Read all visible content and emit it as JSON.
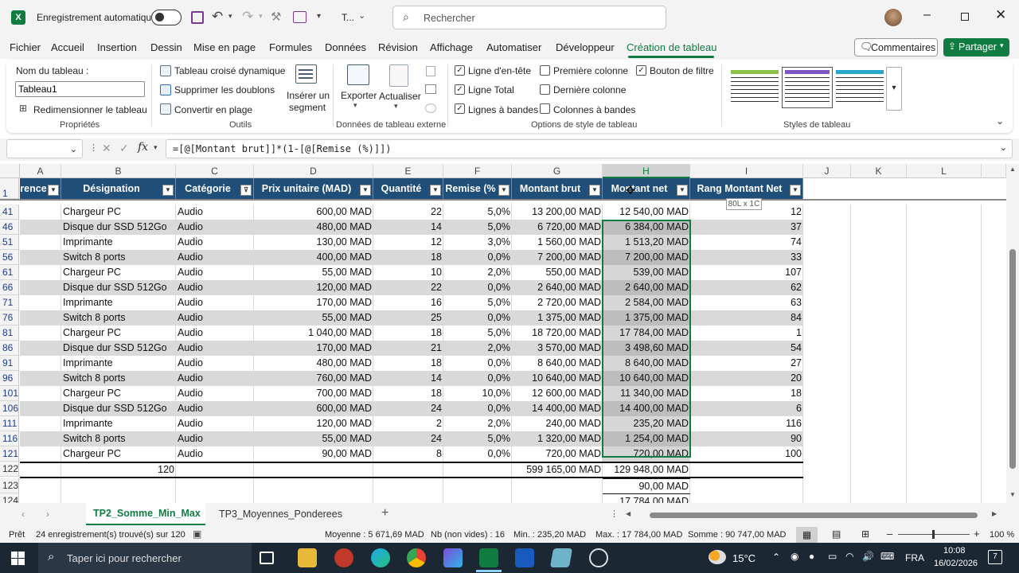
{
  "titlebar": {
    "autosave_label": "Enregistrement automatique",
    "doc_short": "T...",
    "search_placeholder": "Rechercher"
  },
  "menu": [
    "Fichier",
    "Accueil",
    "Insertion",
    "Dessin",
    "Mise en page",
    "Formules",
    "Données",
    "Révision",
    "Affichage",
    "Automatiser",
    "Développeur",
    "Création de tableau"
  ],
  "actions": {
    "comments": "Commentaires",
    "share": "Partager"
  },
  "ribbon": {
    "properties": {
      "table_name_label": "Nom du tableau :",
      "table_name_value": "Tableau1",
      "resize": "Redimensionner le tableau",
      "group": "Propriétés"
    },
    "tools": {
      "pivot": "Tableau croisé dynamique",
      "dedupe": "Supprimer les doublons",
      "convert": "Convertir en plage",
      "slicer_1": "Insérer un",
      "slicer_2": "segment",
      "group": "Outils"
    },
    "external": {
      "export": "Exporter",
      "refresh": "Actualiser",
      "group": "Données de tableau externe"
    },
    "style_options": {
      "header_row": "Ligne d'en-tête",
      "total_row": "Ligne Total",
      "banded_rows": "Lignes à bandes",
      "first_col": "Première colonne",
      "last_col": "Dernière colonne",
      "banded_cols": "Colonnes à bandes",
      "filter_button": "Bouton de filtre",
      "group": "Options de style de tableau"
    },
    "styles": {
      "group": "Styles de tableau"
    }
  },
  "formula": {
    "value": "=[@[Montant brut]]*(1-[@[Remise (%)]])"
  },
  "columns": [
    "A",
    "B",
    "C",
    "D",
    "E",
    "F",
    "G",
    "H",
    "I",
    "J",
    "K",
    "L"
  ],
  "table_headers": [
    "rence",
    "Désignation",
    "Catégorie",
    "Prix unitaire (MAD)",
    "Quantité",
    "Remise (%",
    "Montant brut",
    "Montant net",
    "Rang Montant Net"
  ],
  "tooltip": "80L x 1C",
  "rows": [
    {
      "n": "41",
      "b": "Chargeur PC",
      "c": "Audio",
      "d": "600,00 MAD",
      "e": "22",
      "f": "5,0%",
      "g": "13 200,00 MAD",
      "h": "12 540,00 MAD",
      "i": "12"
    },
    {
      "n": "46",
      "b": "Disque dur SSD 512Go",
      "c": "Audio",
      "d": "480,00 MAD",
      "e": "14",
      "f": "5,0%",
      "g": "6 720,00 MAD",
      "h": "6 384,00 MAD",
      "i": "37"
    },
    {
      "n": "51",
      "b": "Imprimante",
      "c": "Audio",
      "d": "130,00 MAD",
      "e": "12",
      "f": "3,0%",
      "g": "1 560,00 MAD",
      "h": "1 513,20 MAD",
      "i": "74"
    },
    {
      "n": "56",
      "b": "Switch 8 ports",
      "c": "Audio",
      "d": "400,00 MAD",
      "e": "18",
      "f": "0,0%",
      "g": "7 200,00 MAD",
      "h": "7 200,00 MAD",
      "i": "33"
    },
    {
      "n": "61",
      "b": "Chargeur PC",
      "c": "Audio",
      "d": "55,00 MAD",
      "e": "10",
      "f": "2,0%",
      "g": "550,00 MAD",
      "h": "539,00 MAD",
      "i": "107"
    },
    {
      "n": "66",
      "b": "Disque dur SSD 512Go",
      "c": "Audio",
      "d": "120,00 MAD",
      "e": "22",
      "f": "0,0%",
      "g": "2 640,00 MAD",
      "h": "2 640,00 MAD",
      "i": "62"
    },
    {
      "n": "71",
      "b": "Imprimante",
      "c": "Audio",
      "d": "170,00 MAD",
      "e": "16",
      "f": "5,0%",
      "g": "2 720,00 MAD",
      "h": "2 584,00 MAD",
      "i": "63"
    },
    {
      "n": "76",
      "b": "Switch 8 ports",
      "c": "Audio",
      "d": "55,00 MAD",
      "e": "25",
      "f": "0,0%",
      "g": "1 375,00 MAD",
      "h": "1 375,00 MAD",
      "i": "84"
    },
    {
      "n": "81",
      "b": "Chargeur PC",
      "c": "Audio",
      "d": "1 040,00 MAD",
      "e": "18",
      "f": "5,0%",
      "g": "18 720,00 MAD",
      "h": "17 784,00 MAD",
      "i": "1"
    },
    {
      "n": "86",
      "b": "Disque dur SSD 512Go",
      "c": "Audio",
      "d": "170,00 MAD",
      "e": "21",
      "f": "2,0%",
      "g": "3 570,00 MAD",
      "h": "3 498,60 MAD",
      "i": "54"
    },
    {
      "n": "91",
      "b": "Imprimante",
      "c": "Audio",
      "d": "480,00 MAD",
      "e": "18",
      "f": "0,0%",
      "g": "8 640,00 MAD",
      "h": "8 640,00 MAD",
      "i": "27"
    },
    {
      "n": "96",
      "b": "Switch 8 ports",
      "c": "Audio",
      "d": "760,00 MAD",
      "e": "14",
      "f": "0,0%",
      "g": "10 640,00 MAD",
      "h": "10 640,00 MAD",
      "i": "20"
    },
    {
      "n": "101",
      "b": "Chargeur PC",
      "c": "Audio",
      "d": "700,00 MAD",
      "e": "18",
      "f": "10,0%",
      "g": "12 600,00 MAD",
      "h": "11 340,00 MAD",
      "i": "18"
    },
    {
      "n": "106",
      "b": "Disque dur SSD 512Go",
      "c": "Audio",
      "d": "600,00 MAD",
      "e": "24",
      "f": "0,0%",
      "g": "14 400,00 MAD",
      "h": "14 400,00 MAD",
      "i": "6"
    },
    {
      "n": "111",
      "b": "Imprimante",
      "c": "Audio",
      "d": "120,00 MAD",
      "e": "2",
      "f": "2,0%",
      "g": "240,00 MAD",
      "h": "235,20 MAD",
      "i": "116"
    },
    {
      "n": "116",
      "b": "Switch 8 ports",
      "c": "Audio",
      "d": "55,00 MAD",
      "e": "24",
      "f": "5,0%",
      "g": "1 320,00 MAD",
      "h": "1 254,00 MAD",
      "i": "90"
    },
    {
      "n": "121",
      "b": "Chargeur PC",
      "c": "Audio",
      "d": "90,00 MAD",
      "e": "8",
      "f": "0,0%",
      "g": "720,00 MAD",
      "h": "720,00 MAD",
      "i": "100"
    }
  ],
  "total_row": {
    "n": "122",
    "b": "120",
    "g": "599 165,00 MAD",
    "h": "129 948,00 MAD"
  },
  "extra_rows": [
    {
      "n": "123",
      "h": "90,00 MAD"
    },
    {
      "n": "124",
      "h": "17 784,00 MAD"
    }
  ],
  "sheets": [
    "TP2_Somme_Min_Max",
    "TP3_Moyennes_Ponderees"
  ],
  "status": {
    "ready": "Prêt",
    "filter_info": "24 enregistrement(s) trouvé(s) sur 120",
    "average": "Moyenne : 5 671,69 MAD",
    "count": "Nb (non vides) : 16",
    "min": "Min. : 235,20 MAD",
    "max": "Max. : 17 784,00 MAD",
    "sum": "Somme : 90 747,00 MAD",
    "zoom": "100 %"
  },
  "taskbar": {
    "search_placeholder": "Taper ici pour rechercher",
    "temp": "15°C",
    "lang": "FRA",
    "time": "10:08",
    "date": "16/02/2026",
    "notif": "7"
  }
}
